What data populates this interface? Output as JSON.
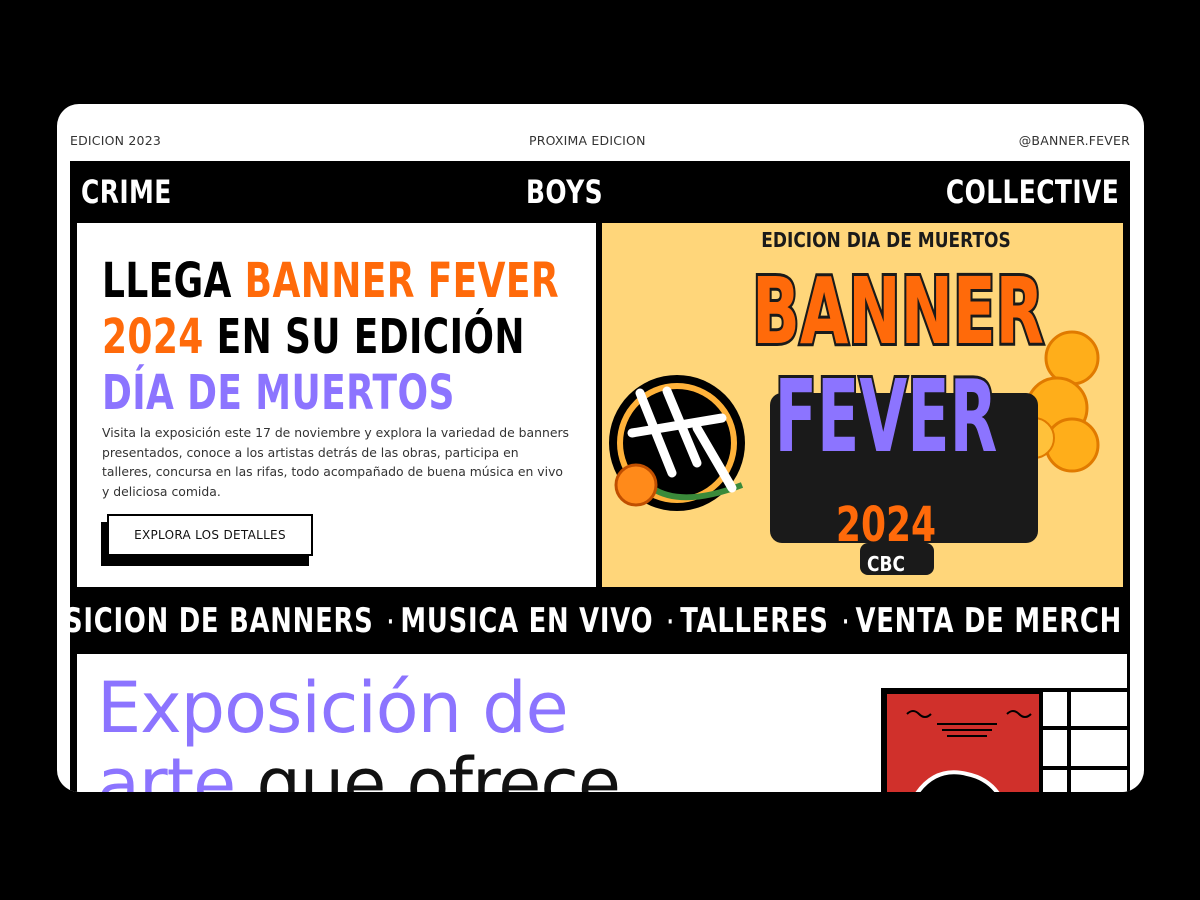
{
  "topbar": {
    "left": "EDICION 2023",
    "center": "PROXIMA EDICION",
    "right": "@BANNER.FEVER"
  },
  "brandbar": {
    "word1": "CRIME",
    "word2": "BOYS",
    "word3": "COLLECTIVE"
  },
  "hero": {
    "headline_1a": "LLEGA ",
    "headline_1b": "BANNER FEVER",
    "headline_2a": "2024",
    "headline_2b": " EN SU EDICIÓN",
    "headline_3": "DÍA DE MUERTOS",
    "description": "Visita la exposición este 17 de noviembre y explora la variedad de banners presentados, conoce a los artistas detrás de las obras, participa en talleres, concursa en las rifas, todo acompañado de buena música en vivo y deliciosa comida.",
    "cta_label": "EXPLORA LOS DETALLES"
  },
  "poster": {
    "edition": "EDICION DIA DE MUERTOS",
    "banner": "BANNER",
    "fever": "FEVER",
    "year": "2024",
    "logo": "CBC"
  },
  "ticker": {
    "items": [
      "SICION DE BANNERS",
      "MUSICA EN VIVO",
      "TALLERES",
      "VENTA DE MERCH"
    ]
  },
  "section2": {
    "line1": "Exposición de",
    "line2a": "arte",
    "line2b": " que ofrece"
  },
  "colors": {
    "orange": "#ff6a0a",
    "purple": "#8c74ff",
    "poster_bg": "#ffd67a",
    "art_red": "#d0302b"
  }
}
